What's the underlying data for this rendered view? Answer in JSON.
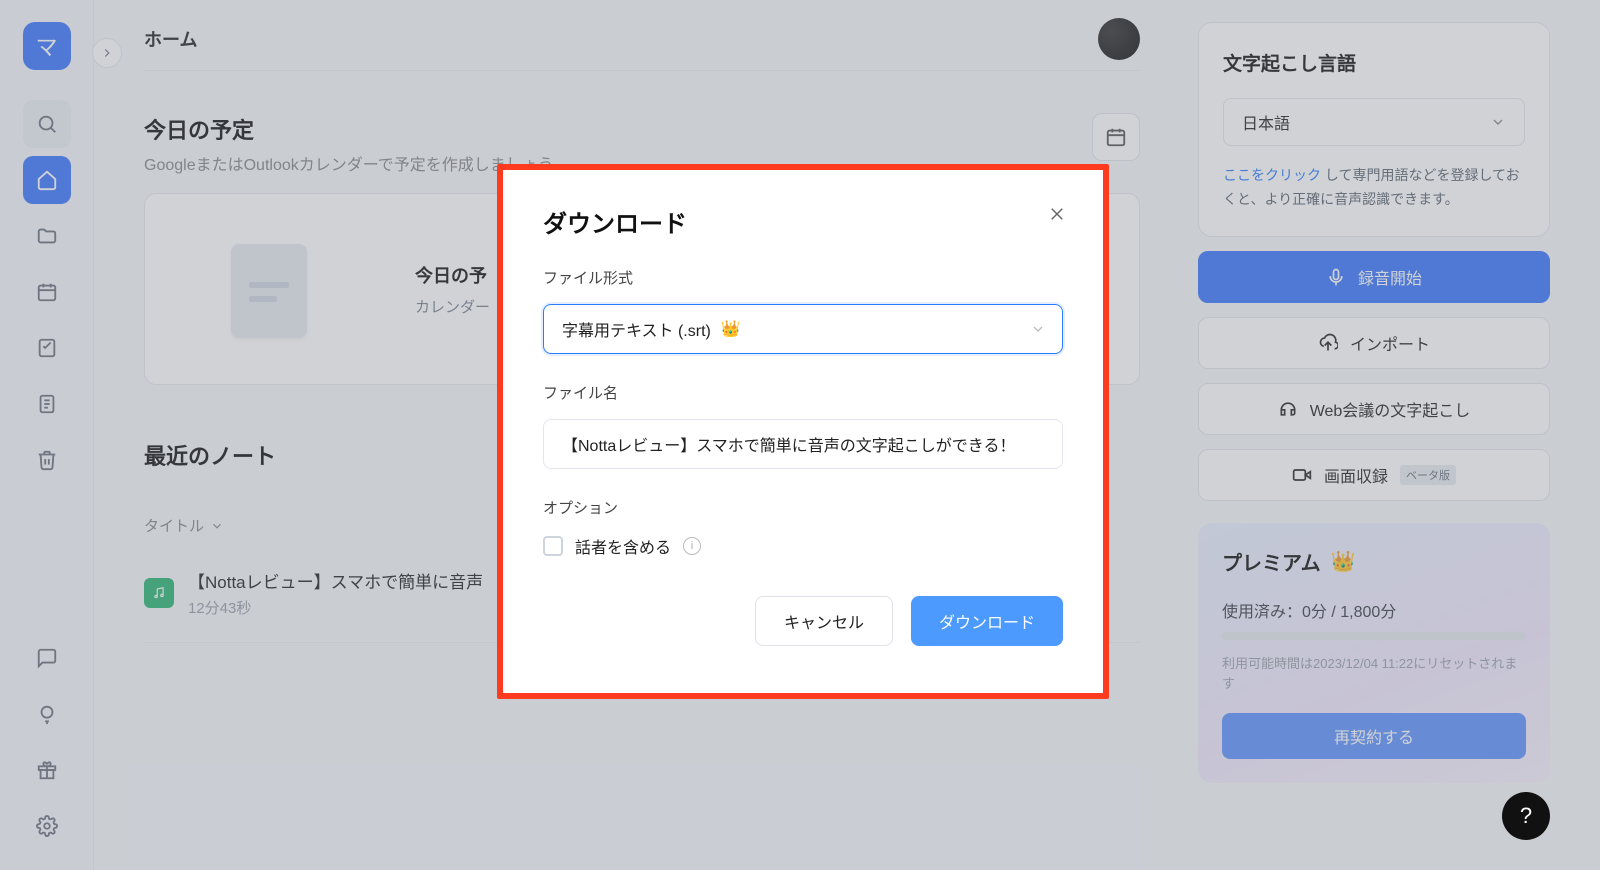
{
  "header": {
    "page_title": "ホーム"
  },
  "sidebar": {
    "logo_letter": "マ"
  },
  "today": {
    "title": "今日の予定",
    "subtitle": "GoogleまたはOutlookカレンダーで予定を作成しましょう。",
    "card_title": "今日の予",
    "card_subtitle": "カレンダー"
  },
  "recent": {
    "title": "最近のノート",
    "column_title": "タイトル",
    "notes": [
      {
        "title": "【Nottaレビュー】スマホで簡単に音声",
        "duration": "12分43秒"
      }
    ]
  },
  "right": {
    "lang_title": "文字起こし言語",
    "lang_value": "日本語",
    "hint_link": "ここをクリック",
    "hint_rest": " して専門用語などを登録しておくと、より正確に音声認識できます。",
    "btn_record": "録音開始",
    "btn_import": "インポート",
    "btn_meeting": "Web会議の文字起こし",
    "btn_screen": "画面収録",
    "btn_screen_badge": "ベータ版"
  },
  "premium": {
    "title": "プレミアム",
    "usage": "使用済み：0分 / 1,800分",
    "reset": "利用可能時間は2023/12/04 11:22にリセットされます",
    "renew": "再契約する"
  },
  "modal": {
    "title": "ダウンロード",
    "file_format_label": "ファイル形式",
    "file_format_value": "字幕用テキスト (.srt)",
    "file_name_label": "ファイル名",
    "file_name_value": "【Nottaレビュー】スマホで簡単に音声の文字起こしができる！",
    "options_label": "オプション",
    "include_speakers": "話者を含める",
    "cancel": "キャンセル",
    "download": "ダウンロード"
  }
}
